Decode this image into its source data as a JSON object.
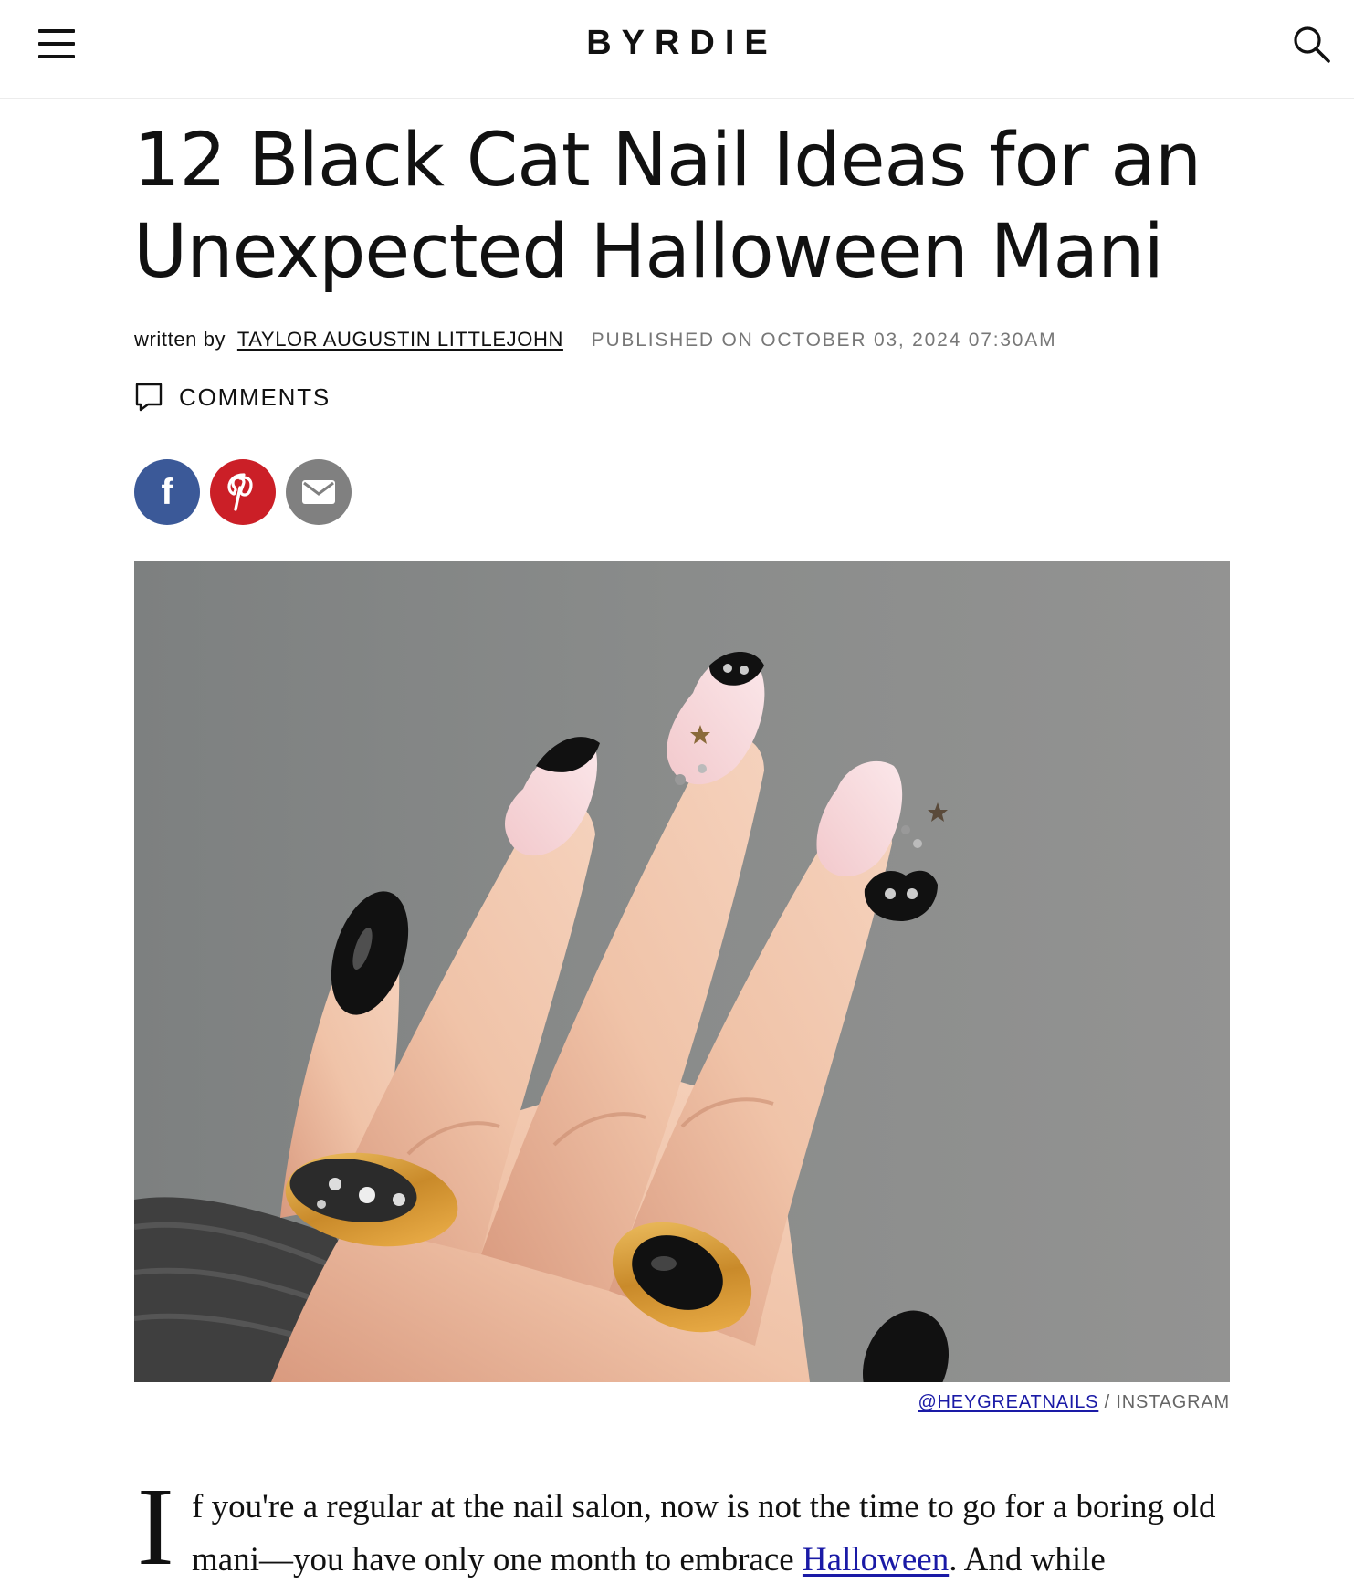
{
  "header": {
    "logo": "BYRDIE",
    "menu_icon": "hamburger-menu-icon",
    "search_icon": "search-icon"
  },
  "article": {
    "title": "12 Black Cat Nail Ideas for an Unexpected Halloween Mani",
    "byline_prefix": "written by",
    "author": "TAYLOR AUGUSTIN LITTLEJOHN",
    "published": "PUBLISHED ON OCTOBER 03, 2024 07:30AM",
    "comments_label": "COMMENTS"
  },
  "share": {
    "facebook_glyph": "f",
    "pinterest_glyph": "P",
    "email_icon": "envelope-icon",
    "colors": {
      "facebook": "#3b5998",
      "pinterest": "#cb1f27",
      "email": "#808080"
    }
  },
  "image": {
    "description_icon": "hero-photo",
    "caption_credit": "@HEYGREATNAILS",
    "caption_separator": " / ",
    "caption_source": "INSTAGRAM"
  },
  "body": {
    "dropcap": "I",
    "text_before_link": "f you're a regular at the nail salon, now is not the time to go for a boring old mani—you have only one month to embrace ",
    "link_text": "Halloween",
    "text_after_link": ". And while"
  },
  "colors": {
    "link": "#1a1aa6",
    "meta_gray": "#777777"
  }
}
